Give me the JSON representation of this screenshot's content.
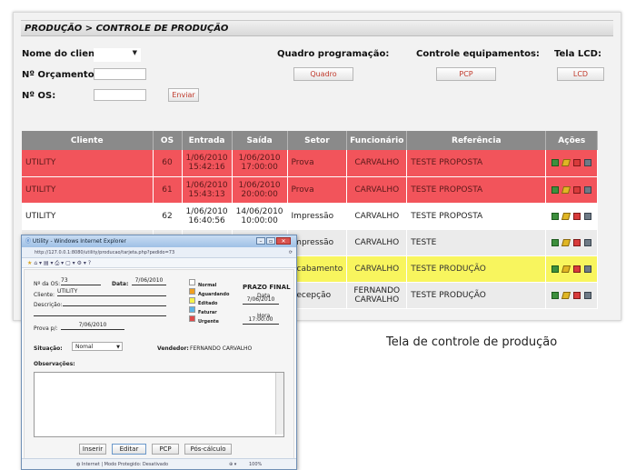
{
  "breadcrumb": "PRODUÇÃO > CONTROLE DE PRODUÇÃO",
  "filters": {
    "cliente_label": "Nome do cliente:",
    "orcamento_label": "Nº Orçamento:",
    "os_label": "Nº OS:",
    "enviar_label": "Enviar"
  },
  "quadro": {
    "label": "Quadro programação:",
    "button": "Quadro"
  },
  "controle": {
    "label": "Controle equipamentos:",
    "button": "PCP"
  },
  "lcd": {
    "label": "Tela LCD:",
    "button": "LCD"
  },
  "table": {
    "headers": [
      "Cliente",
      "OS",
      "Entrada",
      "Saída",
      "Setor",
      "Funcionário",
      "Referência",
      "Ações"
    ],
    "rows": [
      {
        "cliente": "UTILITY",
        "os": "60",
        "entrada": [
          "1/06/2010",
          "15:42:16"
        ],
        "saida": [
          "1/06/2010",
          "17:00:00"
        ],
        "setor": "Prova",
        "funcionario": [
          "CARVALHO"
        ],
        "referencia": "TESTE PROPOSTA"
      },
      {
        "cliente": "UTILITY",
        "os": "61",
        "entrada": [
          "1/06/2010",
          "15:43:13"
        ],
        "saida": [
          "1/06/2010",
          "20:00:00"
        ],
        "setor": "Prova",
        "funcionario": [
          "CARVALHO"
        ],
        "referencia": "TESTE PROPOSTA"
      },
      {
        "cliente": "UTILITY",
        "os": "62",
        "entrada": [
          "1/06/2010",
          "16:40:56"
        ],
        "saida": [
          "14/06/2010",
          "10:00:00"
        ],
        "setor": "Impressão",
        "funcionario": [
          "CARVALHO"
        ],
        "referencia": "TESTE PROPOSTA"
      },
      {
        "cliente": "",
        "os": "",
        "entrada": [
          "",
          ""
        ],
        "saida": [
          "",
          ""
        ],
        "setor": "Impressão",
        "funcionario": [
          "CARVALHO"
        ],
        "referencia": "TESTE"
      },
      {
        "cliente": "",
        "os": "",
        "entrada": [
          "",
          ""
        ],
        "saida": [
          "",
          ""
        ],
        "setor": "Acabamento",
        "funcionario": [
          "CARVALHO"
        ],
        "referencia": "TESTE PRODUÇÃO"
      },
      {
        "cliente": "",
        "os": "",
        "entrada": [
          "",
          ""
        ],
        "saida": [
          "",
          ""
        ],
        "setor": "Recepção",
        "funcionario": [
          "FERNANDO",
          "CARVALHO"
        ],
        "referencia": "TESTE PRODUÇÃO"
      }
    ],
    "row_styles": [
      "red",
      "red",
      "white",
      "grey",
      "yellow",
      "grey"
    ]
  },
  "caption": "Tela de controle de produção",
  "popup": {
    "title": "Utility - Windows Internet Explorer",
    "address": "http://127.0.0.1:8080/utility/producao/tarjeta.php?pedido=73",
    "os_label": "Nº da OS:",
    "os_value": "73",
    "data_label": "Data:",
    "data_value": "7/06/2010",
    "cliente_label": "Cliente:",
    "cliente_value": "UTILITY",
    "descricao_label": "Descrição:",
    "prova_label": "Prova p/:",
    "prova_value": "7/06/2010",
    "legend": [
      {
        "label": "Normal",
        "color": "#ffffff"
      },
      {
        "label": "Aguardando",
        "color": "#f0a020"
      },
      {
        "label": "Editado",
        "color": "#f5f24a"
      },
      {
        "label": "Faturar",
        "color": "#5ab4e8"
      },
      {
        "label": "Urgente",
        "color": "#e04a4a"
      }
    ],
    "prazo_title": "PRAZO FINAL",
    "prazo_data_label": "Data",
    "prazo_data_value": "7/06/2010",
    "prazo_hora_label": "Hora",
    "prazo_hora_value": "17:00:00",
    "situacao_label": "Situação:",
    "situacao_value": "Nomal",
    "vendedor_label": "Vendedor:",
    "vendedor_value": "FERNANDO CARVALHO",
    "observacoes_label": "Observações:",
    "buttons": [
      "Inserir",
      "Editar",
      "PCP",
      "Pós-cálculo"
    ],
    "status": "Internet | Modo Protegido: Desativado",
    "zoom": "100%"
  }
}
